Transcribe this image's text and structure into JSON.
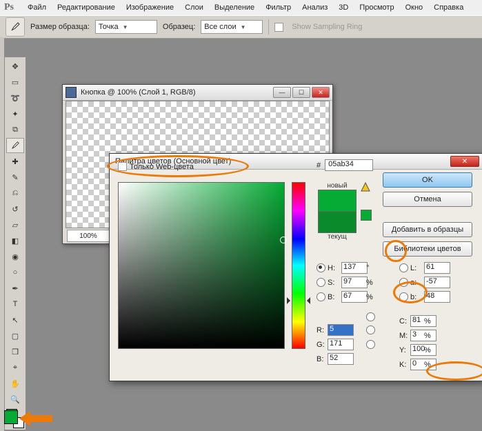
{
  "logo": "Ps",
  "menu": [
    "Файл",
    "Редактирование",
    "Изображение",
    "Слои",
    "Выделение",
    "Фильтр",
    "Анализ",
    "3D",
    "Просмотр",
    "Окно",
    "Справка"
  ],
  "optbar": {
    "sample_size_label": "Размер образца:",
    "sample_size_value": "Точка",
    "sample_label": "Образец:",
    "sample_value": "Все слои",
    "ring_label": "Show Sampling Ring"
  },
  "doc": {
    "title": "Кнопка @ 100% (Слой 1, RGB/8)",
    "zoom": "100%"
  },
  "picker": {
    "title": "Палитра цветов (Основной цвет)",
    "new_label": "новый",
    "current_label": "текущ",
    "ok": "OK",
    "cancel": "Отмена",
    "add": "Добавить в образцы",
    "lib": "Библиотеки цветов",
    "web_only": "Только Web-цвета",
    "hex_label": "#",
    "hex": "05ab34",
    "hsb": {
      "H": "137",
      "S": "97",
      "B": "67"
    },
    "lab": {
      "L": "61",
      "a": "-57",
      "b": "48"
    },
    "rgb": {
      "R": "5",
      "G": "171",
      "B": "52"
    },
    "cmyk": {
      "C": "81",
      "M": "3",
      "Y": "100",
      "K": "0"
    },
    "deg": "°",
    "pct": "%",
    "channels": {
      "H": "H:",
      "S": "S:",
      "Bv": "B:",
      "R": "R:",
      "G": "G:",
      "Bb": "B:",
      "L": "L:",
      "a": "a:",
      "b": "b:",
      "C": "C:",
      "M": "M:",
      "Y": "Y:",
      "K": "K:"
    }
  }
}
